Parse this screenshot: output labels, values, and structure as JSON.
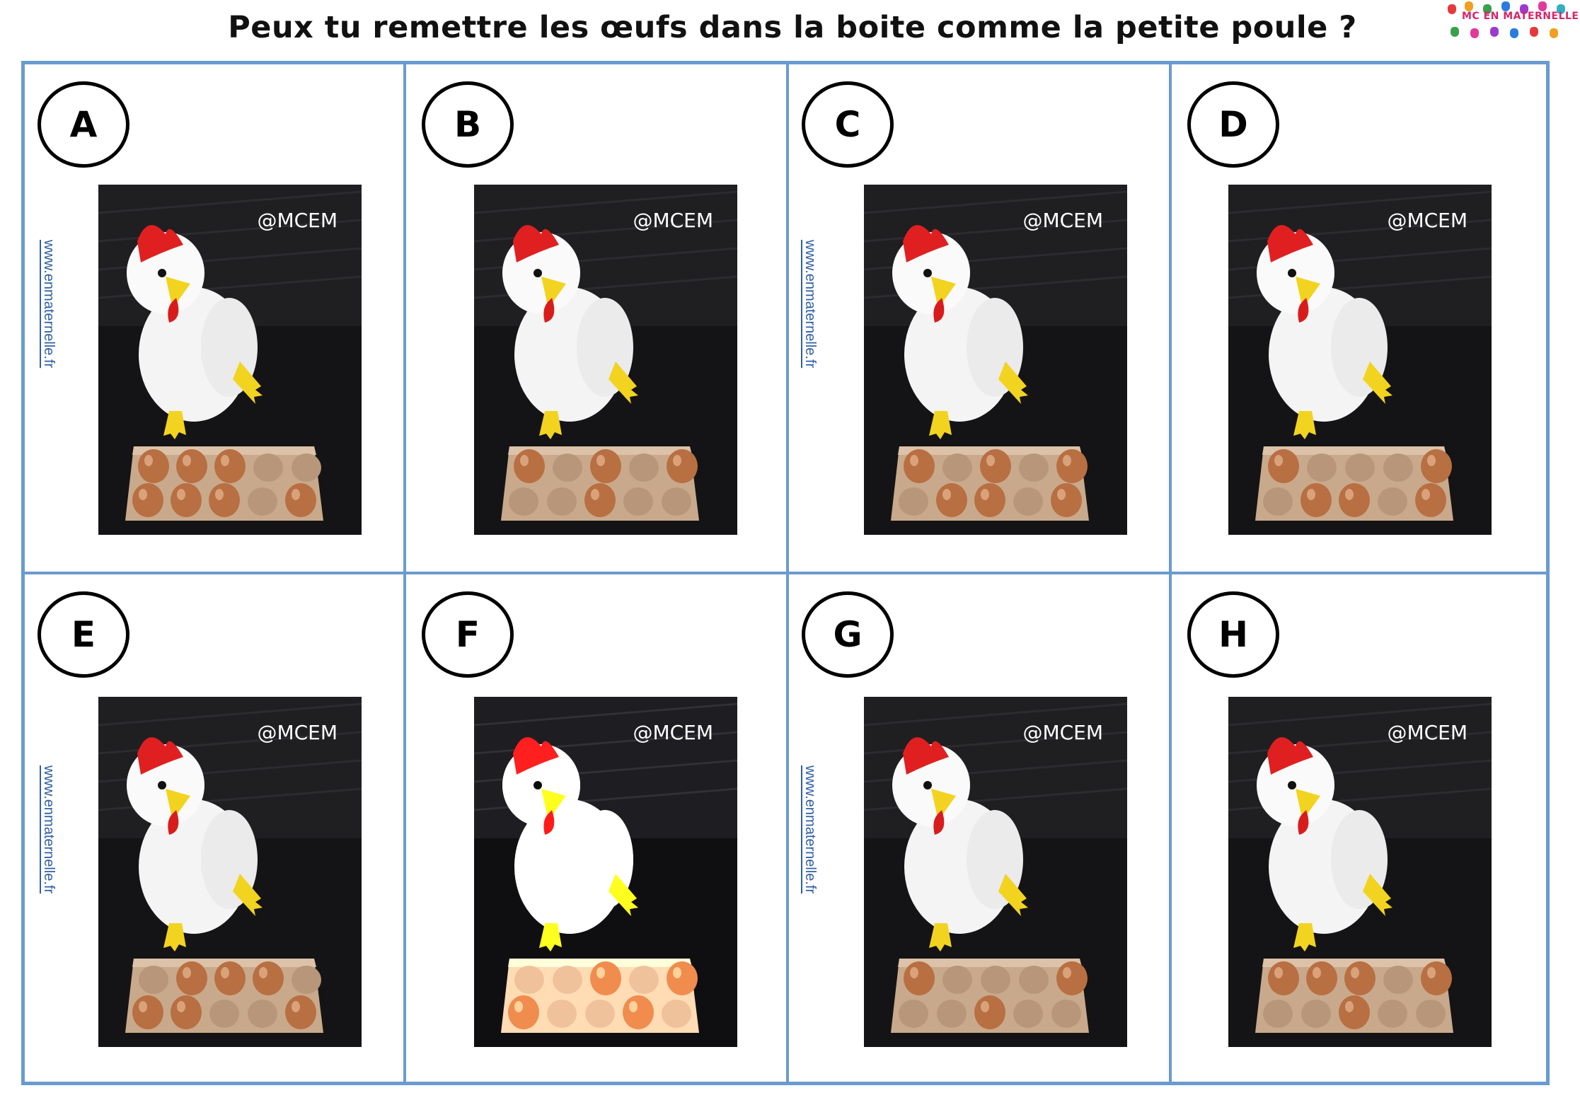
{
  "title": "Peux tu remettre les œufs dans la boite comme la petite poule ?",
  "logo": {
    "text": "MC EN MATERNELLE",
    "icon": "colorful-hands-logo"
  },
  "colors": {
    "grid_border": "#6a9bcf",
    "url_link": "#2f5fa6",
    "egg_brown": "#b86f42",
    "carton": "#c9a98c"
  },
  "watermark": "@MCEM",
  "site_url": "www.enmaternelle.fr",
  "cards": [
    {
      "letter": "A",
      "eggs": [
        1,
        1,
        1,
        0,
        0,
        1,
        1,
        1,
        0,
        1
      ],
      "url_visible": true
    },
    {
      "letter": "B",
      "eggs": [
        1,
        0,
        1,
        0,
        1,
        0,
        0,
        1,
        0,
        0
      ],
      "url_visible": false
    },
    {
      "letter": "C",
      "eggs": [
        1,
        0,
        1,
        0,
        1,
        0,
        1,
        1,
        0,
        1
      ],
      "url_visible": true
    },
    {
      "letter": "D",
      "eggs": [
        1,
        0,
        0,
        0,
        1,
        0,
        1,
        1,
        0,
        1
      ],
      "url_visible": false
    },
    {
      "letter": "E",
      "eggs": [
        0,
        1,
        1,
        1,
        0,
        1,
        1,
        0,
        0,
        1
      ],
      "url_visible": true
    },
    {
      "letter": "F",
      "eggs": [
        0,
        0,
        1,
        0,
        1,
        1,
        0,
        0,
        1,
        0
      ],
      "url_visible": false
    },
    {
      "letter": "G",
      "eggs": [
        1,
        0,
        0,
        0,
        1,
        0,
        0,
        1,
        0,
        0
      ],
      "url_visible": true
    },
    {
      "letter": "H",
      "eggs": [
        1,
        1,
        1,
        0,
        1,
        0,
        0,
        1,
        0,
        0
      ],
      "url_visible": false
    }
  ]
}
